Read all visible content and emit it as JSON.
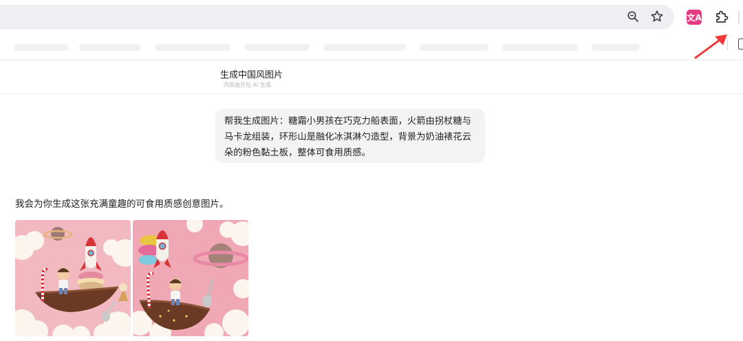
{
  "browser": {
    "icons": [
      "zoom-icon",
      "bookmark-star-icon",
      "translate-extension-icon",
      "extensions-puzzle-icon",
      "side-panel-icon"
    ],
    "translate_badge": "文A",
    "arrow_color": "#ef3b3b"
  },
  "conversation": {
    "title": "生成中国风图片",
    "subtitle": "内容由豆包 AI 生成"
  },
  "user_message": {
    "text": "帮我生成图片：糖霜小男孩在巧克力船表面，火箭由拐杖糖与马卡龙组装，环形山是融化冰淇淋勺造型，背景为奶油裱花云朵的粉色黏土板，整体可食用质感。"
  },
  "assistant_message": {
    "text": "我会为你生成这张充满童趣的可食用质感创意图片。",
    "images": [
      {
        "name": "generated-image-1",
        "bg_color": "#f2b9c0"
      },
      {
        "name": "generated-image-2",
        "bg_color": "#f0a9b4"
      }
    ]
  }
}
